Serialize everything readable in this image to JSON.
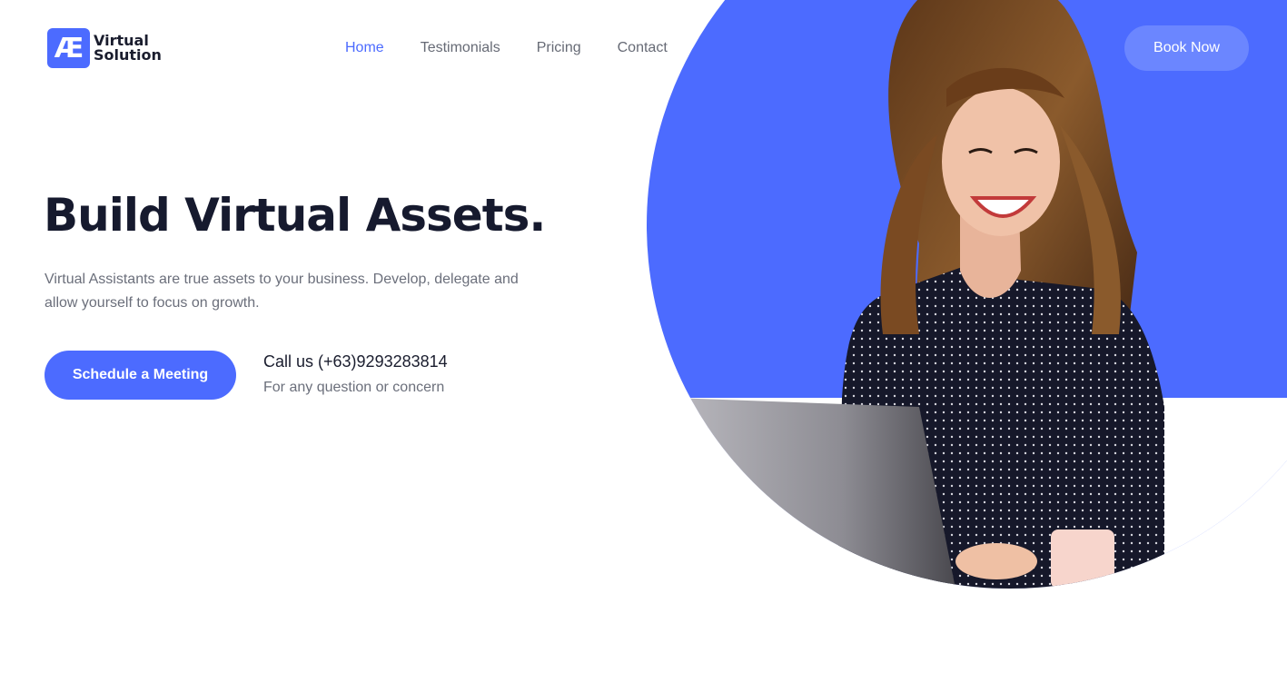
{
  "brand": {
    "logo_mark": "Æ",
    "name_line1": "Virtual",
    "name_line2": "Solution",
    "accent_color": "#4c6bff"
  },
  "nav": {
    "items": [
      {
        "label": "Home",
        "active": true
      },
      {
        "label": "Testimonials",
        "active": false
      },
      {
        "label": "Pricing",
        "active": false
      },
      {
        "label": "Contact",
        "active": false
      }
    ],
    "cta_label": "Book Now"
  },
  "hero": {
    "title": "Build Virtual Assets.",
    "description": "Virtual Assistants are true assets to your business. Develop, delegate and allow yourself to focus on growth.",
    "primary_button": "Schedule a Meeting",
    "call_text": "Call us (+63)9293283814",
    "call_subtext": "For any question or concern",
    "image_icon": "woman-with-laptop-photo"
  }
}
